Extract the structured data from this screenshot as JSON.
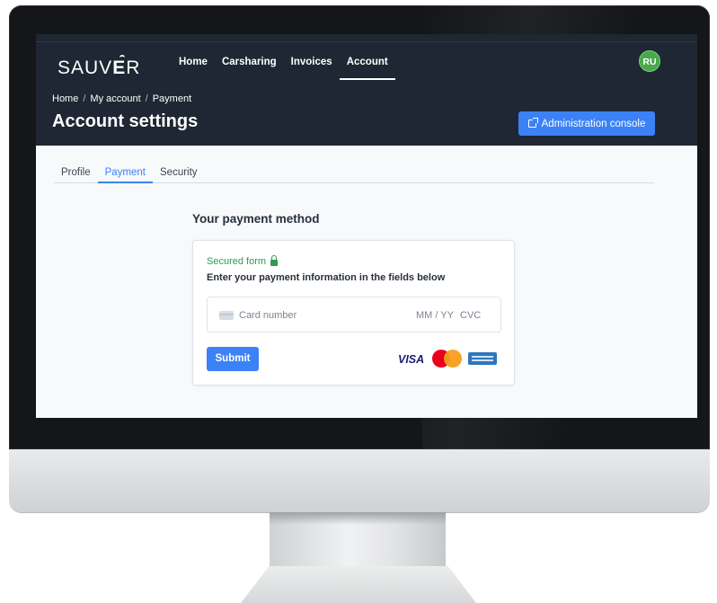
{
  "header": {
    "logo": {
      "text_main": "SAUV",
      "text_accent": "E",
      "text_end": "R"
    },
    "nav": [
      {
        "label": "Home",
        "active": false
      },
      {
        "label": "Carsharing",
        "active": false
      },
      {
        "label": "Invoices",
        "active": false
      },
      {
        "label": "Account",
        "active": true
      }
    ],
    "avatar_initials": "RU",
    "avatar_color": "#48a84a",
    "breadcrumb": [
      "Home",
      "My account",
      "Payment"
    ],
    "breadcrumb_separator": "/",
    "title": "Account settings",
    "admin_button_label": "Administration console",
    "admin_button_icon": "external-link-icon"
  },
  "tabs": [
    {
      "label": "Profile",
      "active": false
    },
    {
      "label": "Payment",
      "active": true
    },
    {
      "label": "Security",
      "active": false
    }
  ],
  "payment": {
    "section_title": "Your payment method",
    "secured_label": "Secured form",
    "secured_icon": "lock-icon",
    "instructions": "Enter your payment information in the fields below",
    "card_field": {
      "card_number_placeholder": "Card number",
      "expiry_placeholder": "MM / YY",
      "cvc_placeholder": "CVC"
    },
    "submit_label": "Submit",
    "card_brands": [
      "VISA",
      "mastercard",
      "american-express"
    ]
  },
  "colors": {
    "header_bg": "#1e2733",
    "accent": "#3b82f6",
    "secured_green": "#2f9a56"
  }
}
